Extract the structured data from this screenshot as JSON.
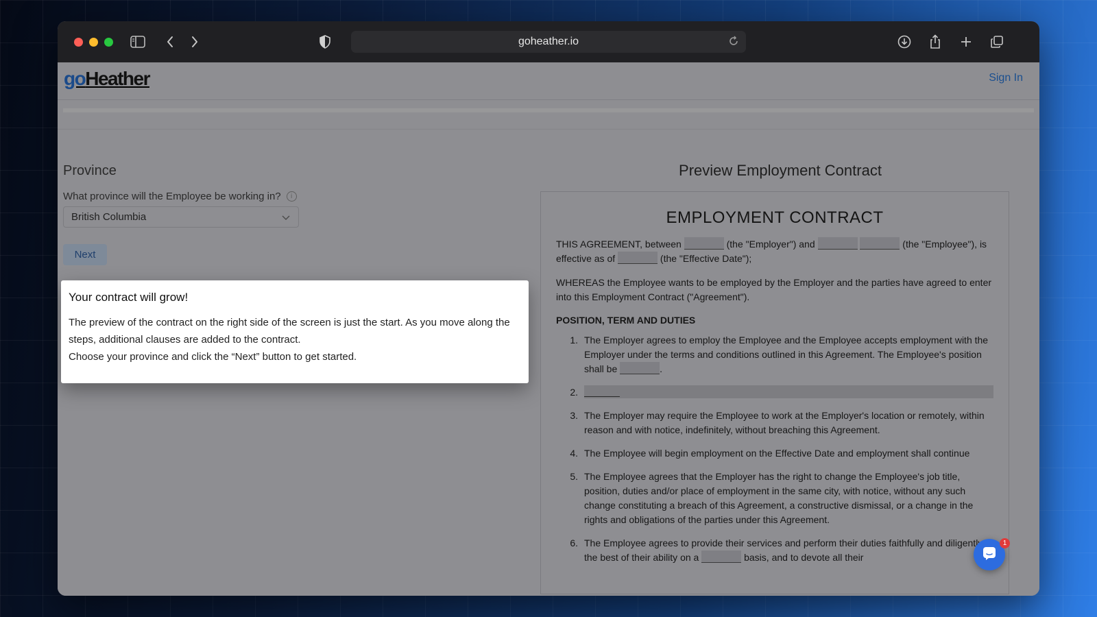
{
  "browser": {
    "url": "goheather.io",
    "icons": [
      "sidebar-icon",
      "back-icon",
      "forward-icon",
      "shield-icon",
      "reload-icon",
      "download-icon",
      "share-icon",
      "new-tab-icon",
      "tabs-overview-icon"
    ]
  },
  "header": {
    "logo_go": "go",
    "logo_rest": "Heather",
    "sign_in": "Sign In"
  },
  "form": {
    "section_title": "Province",
    "question": "What province will the Employee be working in?",
    "info_icon_glyph": "i",
    "selected_province": "British Columbia",
    "next_label": "Next"
  },
  "popover": {
    "title": "Your contract will grow!",
    "line1": "The preview of the contract on the right side of the screen is just the start. As you move along the steps, additional clauses are added to the contract.",
    "line2": "Choose your province and click the “Next” button to get started."
  },
  "preview": {
    "title": "Preview Employment Contract",
    "heading": "EMPLOYMENT CONTRACT",
    "intro_a": "THIS AGREEMENT, between",
    "intro_b": "(the \"Employer\") and",
    "intro_c": "(the \"Employee\"), is effective as of",
    "intro_d": "(the \"Effective Date\");",
    "whereas": "WHEREAS the Employee wants to be employed by the Employer and the parties have agreed to enter into this Employment Contract (\"Agreement\").",
    "section_heading": "POSITION, TERM AND DUTIES",
    "clauses": [
      {
        "num": "1.",
        "text": "The Employer agrees to employ the Employee and the Employee accepts employment with the Employer under the terms and conditions outlined in this Agreement. The Employee's position shall be",
        "tail": "."
      },
      {
        "num": "2.",
        "text": ""
      },
      {
        "num": "3.",
        "text": "The Employer may require the Employee to work at the Employer's location or remotely, within reason and with notice, indefinitely, without breaching this Agreement."
      },
      {
        "num": "4.",
        "text": "The Employee will begin employment on the Effective Date and employment shall continue"
      },
      {
        "num": "5.",
        "text": "The Employee agrees that the Employer has the right to change the Employee's job title, position, duties and/or place of employment in the same city, with notice, without any such change constituting a breach of this Agreement, a constructive dismissal, or a change in the rights and obligations of the parties under this Agreement."
      },
      {
        "num": "6.",
        "text": "The Employee agrees to provide their services and perform their duties faithfully and diligently to the best of their ability on a",
        "tail": "basis, and to devote all their"
      }
    ]
  },
  "chat": {
    "badge_count": "1"
  },
  "colors": {
    "accent": "#2d6cdf",
    "badge": "#e03b3b",
    "link": "#1a4f8f"
  }
}
